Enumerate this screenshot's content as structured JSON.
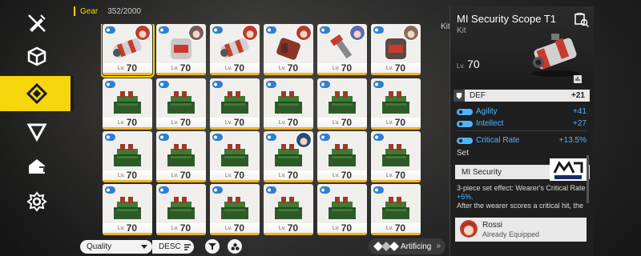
{
  "header": {
    "label": "Gear",
    "count": "352/2000"
  },
  "nav": [
    "pencil-strike-icon",
    "cube-icon",
    "gear-diamond-icon",
    "triangle-icon",
    "house-arrow-icon",
    "hex-flower-icon"
  ],
  "grid": {
    "rows": [
      [
        {
          "level_label": "Lv.",
          "level": "70",
          "kind": "scope"
        },
        {
          "level_label": "Lv.",
          "level": "70",
          "kind": "armor"
        },
        {
          "level_label": "Lv.",
          "level": "70",
          "kind": "scope"
        },
        {
          "level_label": "Lv.",
          "level": "70",
          "kind": "gauntlet"
        },
        {
          "level_label": "Lv.",
          "level": "70",
          "kind": "tool"
        },
        {
          "level_label": "Lv.",
          "level": "70",
          "kind": "vest"
        }
      ],
      [
        {
          "level_label": "Lv.",
          "level": "70",
          "kind": "cube"
        },
        {
          "level_label": "Lv.",
          "level": "70",
          "kind": "cube"
        },
        {
          "level_label": "Lv.",
          "level": "70",
          "kind": "cube"
        },
        {
          "level_label": "Lv.",
          "level": "70",
          "kind": "cube"
        },
        {
          "level_label": "Lv.",
          "level": "70",
          "kind": "cube"
        },
        {
          "level_label": "Lv.",
          "level": "70",
          "kind": "cube"
        }
      ],
      [
        {
          "level_label": "Lv.",
          "level": "70",
          "kind": "cube"
        },
        {
          "level_label": "Lv.",
          "level": "70",
          "kind": "cube"
        },
        {
          "level_label": "Lv.",
          "level": "70",
          "kind": "cube"
        },
        {
          "level_label": "Lv.",
          "level": "70",
          "kind": "cube"
        },
        {
          "level_label": "Lv.",
          "level": "70",
          "kind": "cube"
        },
        {
          "level_label": "Lv.",
          "level": "70",
          "kind": "cube"
        }
      ],
      [
        {
          "level_label": "Lv.",
          "level": "70",
          "kind": "cube"
        },
        {
          "level_label": "Lv.",
          "level": "70",
          "kind": "cube"
        },
        {
          "level_label": "Lv.",
          "level": "70",
          "kind": "cube"
        },
        {
          "level_label": "Lv.",
          "level": "70",
          "kind": "cube"
        },
        {
          "level_label": "Lv.",
          "level": "70",
          "kind": "cube"
        },
        {
          "level_label": "Lv.",
          "level": "70",
          "kind": "cube"
        }
      ]
    ]
  },
  "panel": {
    "title": "MI Security Scope T1",
    "type": "Kit",
    "level_label": "Lv.",
    "level": "70",
    "main_stat": {
      "name": "DEF",
      "value": "+21"
    },
    "stats": [
      {
        "name": "Agility",
        "value": "+41"
      },
      {
        "name": "Intellect",
        "value": "+27"
      },
      {
        "name": "Critical Rate",
        "value": "+13.5%"
      }
    ],
    "set_label": "Set",
    "set_name": "MI Security",
    "set_desc_1": "3-piece set effect: Wearer's Critical Rate",
    "set_desc_hl": "+5%.",
    "set_desc_2": "After the wearer scores a critical hit, the",
    "equipped_name": "Rossi",
    "equipped_status": "Already Equipped",
    "side_tag": "Kit"
  },
  "bottom": {
    "sort": "Quality",
    "order": "DESC",
    "artificing": "Artificing"
  },
  "colors": {
    "accent": "#f5d50c",
    "stat_blue": "#4fb3ff",
    "level_bar": "#f0b522"
  }
}
